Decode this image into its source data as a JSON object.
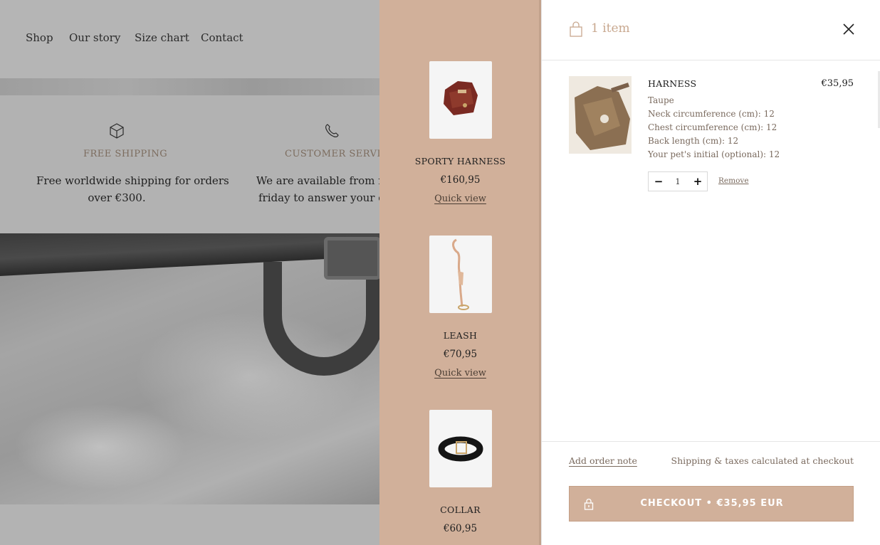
{
  "background_page": {
    "nav": [
      "Shop",
      "Our story",
      "Size chart",
      "Contact"
    ],
    "features": [
      {
        "icon": "box-icon",
        "title": "FREE SHIPPING",
        "text_line1": "Free worldwide shipping for orders",
        "text_line2": "over €300."
      },
      {
        "icon": "phone-icon",
        "title": "CUSTOMER SERVICE",
        "text_line1": "We are available from mon",
        "text_line2": "friday to answer your ques"
      }
    ]
  },
  "recommendations": {
    "items": [
      {
        "name": "SPORTY HARNESS",
        "price": "€160,95",
        "link": "Quick view"
      },
      {
        "name": "LEASH",
        "price": "€70,95",
        "link": "Quick view"
      },
      {
        "name": "COLLAR",
        "price": "€60,95",
        "link": "Quick view"
      }
    ]
  },
  "cart": {
    "count_label": "1 item",
    "line": {
      "title": "HARNESS",
      "price": "€35,95",
      "properties": [
        "Taupe",
        "Neck circumference (cm): 12",
        "Chest circumference (cm): 12",
        "Back length (cm): 12",
        "Your pet's initial (optional): 12"
      ],
      "quantity": "1",
      "remove_label": "Remove"
    },
    "footer": {
      "order_note": "Add order note",
      "shipping_note": "Shipping & taxes calculated at checkout",
      "checkout_label": "CHECKOUT  •  €35,95 EUR"
    }
  },
  "colors": {
    "accent": "#d1b09a",
    "muted_text": "#7a6a5e",
    "count_text": "#c8a88f"
  }
}
